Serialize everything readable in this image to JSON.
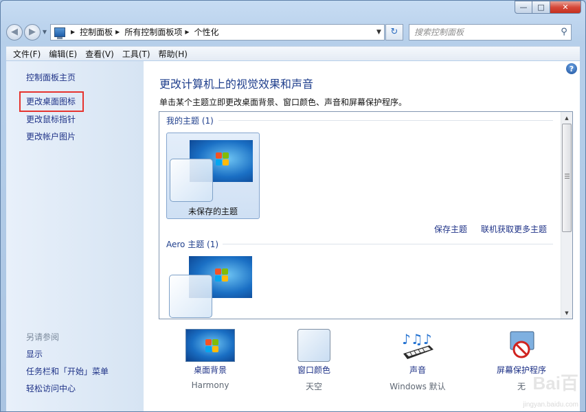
{
  "window": {
    "buttons": {
      "minimize": "—",
      "maximize": "□",
      "close": "✕"
    }
  },
  "nav": {
    "breadcrumbs": [
      "控制面板",
      "所有控制面板项",
      "个性化"
    ],
    "search_placeholder": "搜索控制面板"
  },
  "menu": [
    "文件(F)",
    "编辑(E)",
    "查看(V)",
    "工具(T)",
    "帮助(H)"
  ],
  "sidebar": {
    "home": "控制面板主页",
    "links": [
      "更改桌面图标",
      "更改鼠标指针",
      "更改帐户图片"
    ],
    "see_also_title": "另请参阅",
    "see_also": [
      "显示",
      "任务栏和「开始」菜单",
      "轻松访问中心"
    ],
    "highlight_color": "#e6322d"
  },
  "main": {
    "title": "更改计算机上的视觉效果和声音",
    "subtitle": "单击某个主题立即更改桌面背景、窗口颜色、声音和屏幕保护程序。",
    "my_themes": {
      "label": "我的主题 (1)",
      "items": [
        {
          "name": "未保存的主题"
        }
      ]
    },
    "actions": [
      "保存主题",
      "联机获取更多主题"
    ],
    "aero_themes": {
      "label": "Aero 主题 (1)"
    }
  },
  "bottom": [
    {
      "label": "桌面背景",
      "value": "Harmony",
      "icon": "desktop-background-icon"
    },
    {
      "label": "窗口颜色",
      "value": "天空",
      "icon": "window-color-icon"
    },
    {
      "label": "声音",
      "value": "Windows 默认",
      "icon": "sound-icon"
    },
    {
      "label": "屏幕保护程序",
      "value": "无",
      "icon": "screensaver-icon"
    }
  ],
  "watermark": {
    "logo": "Bai百",
    "url": "jingyan.baidu.com"
  },
  "colors": {
    "link": "#1e3287",
    "heading": "#1e3e8c",
    "accent": "#2a6bbf"
  }
}
